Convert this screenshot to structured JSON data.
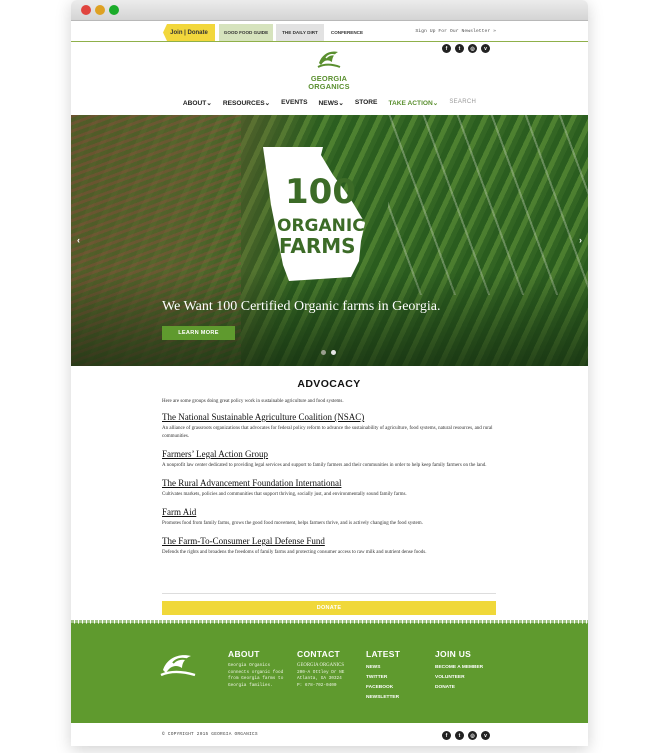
{
  "topbar": {
    "join": "Join | Donate",
    "tabs": [
      "GOOD FOOD GUIDE",
      "THE DAILY DIRT",
      "CONFERENCE"
    ],
    "signup": "Sign Up For Our Newsletter »"
  },
  "social_icons": [
    "facebook-icon",
    "twitter-icon",
    "instagram-icon",
    "vimeo-icon"
  ],
  "social_glyphs": [
    "f",
    "t",
    "◎",
    "v"
  ],
  "logo": {
    "line1": "GEORGIA",
    "line2": "ORGANICS"
  },
  "nav": {
    "about": "ABOUT",
    "resources": "RESOURCES",
    "events": "EVENTS",
    "news": "NEWS",
    "store": "STORE",
    "take_action": "TAKE ACTION",
    "search": "SEARCH"
  },
  "hero": {
    "graphic_line1": "100",
    "graphic_line2": "ORGANIC",
    "graphic_line3": "FARMS",
    "headline": "We Want 100 Certified Organic farms in Georgia.",
    "button": "LEARN MORE"
  },
  "advocacy": {
    "title": "ADVOCACY",
    "intro": "Here are some groups doing great policy work in sustainable agriculture and food systems.",
    "orgs": [
      {
        "title": "The National Sustainable Agriculture Coalition (NSAC)",
        "desc": "An alliance of grassroots organizations that advocates for federal policy reform to advance the sustainability of agriculture, food systems, natural resources, and rural communities."
      },
      {
        "title": "Farmers’ Legal Action Group",
        "desc": "A nonprofit law center dedicated to providing legal services and support to family farmers and their communities in order to help keep family farmers on the land."
      },
      {
        "title": "The Rural Advancement Foundation International",
        "desc": "Cultivates markets, policies and communities that support thriving, socially just, and environmentally sound family farms."
      },
      {
        "title": "Farm Aid",
        "desc": "Promotes food from family farms, grows the good food movement, helps farmers thrive, and is actively changing the food system."
      },
      {
        "title": "The Farm-To-Consumer Legal Defense Fund",
        "desc": "Defends the rights and broadens the freedoms of family farms and protecting consumer access to raw milk and nutrient dense foods."
      }
    ]
  },
  "donate_bar": "DONATE",
  "footer": {
    "about_title": "ABOUT",
    "about_text": "Georgia Organics connects organic food from Georgia farms to Georgia families.",
    "contact_title": "CONTACT",
    "contact_name": "GEORGIA ORGANICS",
    "contact_addr1": "200-A Ottley Dr NE",
    "contact_addr2": "Atlanta, GA 30324",
    "contact_phone": "P: 678-702-0400",
    "latest_title": "LATEST",
    "latest_links": [
      "NEWS",
      "TWITTER",
      "FACEBOOK",
      "NEWSLETTER"
    ],
    "join_title": "JOIN US",
    "join_links": [
      "BECOME A MEMBER",
      "VOLUNTEER",
      "DONATE"
    ],
    "copyright": "© COPYRIGHT 2015 GEORGIA ORGANICS"
  }
}
